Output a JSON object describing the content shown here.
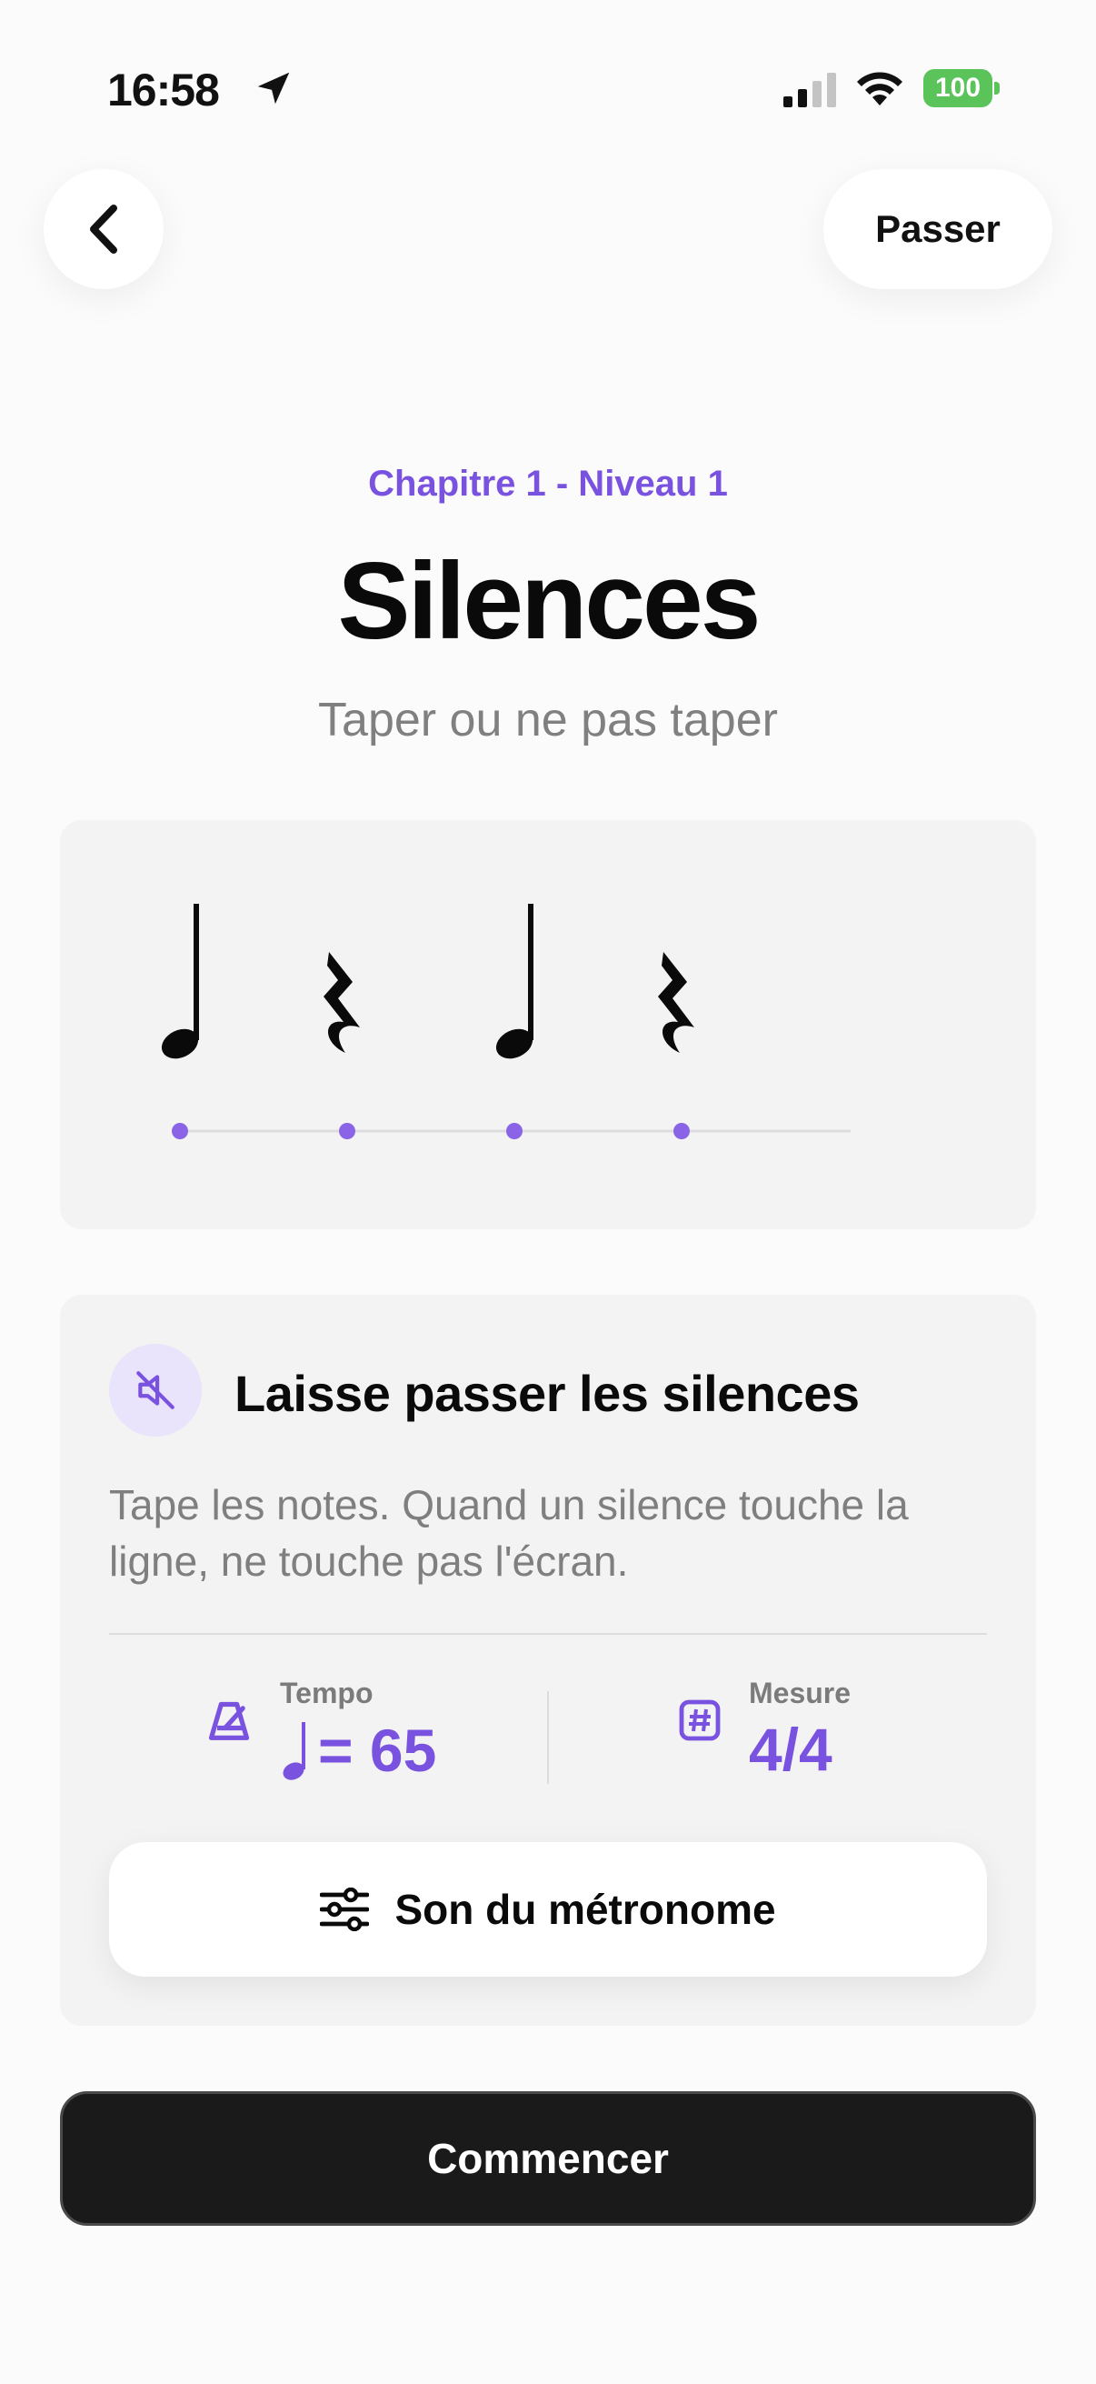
{
  "status_bar": {
    "time": "16:58",
    "battery": "100",
    "battery_color": "#5ac35a"
  },
  "nav": {
    "back_icon": "chevron-left-icon",
    "skip_label": "Passer"
  },
  "header": {
    "chapter": "Chapitre 1 - Niveau 1",
    "title": "Silences",
    "subtitle": "Taper ou ne pas taper"
  },
  "rhythm": {
    "symbols": [
      "quarter-note",
      "quarter-rest",
      "quarter-note",
      "quarter-rest"
    ],
    "accent_color": "#7a52e0"
  },
  "instruction": {
    "icon": "speaker-muted-icon",
    "title": "Laisse passer les silences",
    "text": "Tape les notes. Quand un silence touche la ligne, ne touche pas l'écran."
  },
  "stats": {
    "tempo_label": "Tempo",
    "tempo_value": "= 65",
    "measure_label": "Mesure",
    "measure_value": "4/4"
  },
  "metronome_button": {
    "icon": "sliders-icon",
    "label": "Son du métronome"
  },
  "start_button": {
    "label": "Commencer"
  },
  "colors": {
    "accent": "#7a52e0",
    "background": "#fbfbfb",
    "card": "#f3f3f3",
    "primary_button": "#1a1a1a"
  }
}
